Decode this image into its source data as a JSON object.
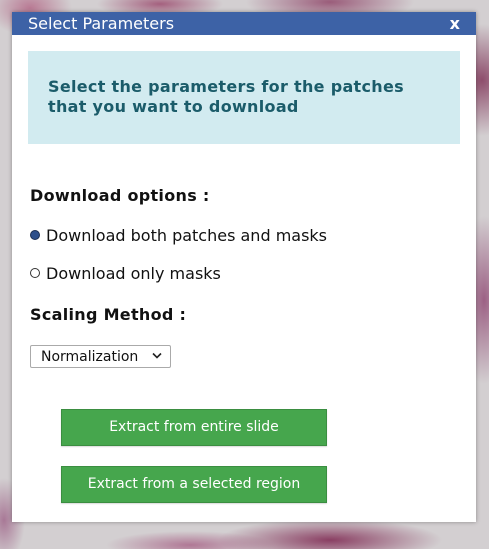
{
  "dialog": {
    "title": "Select Parameters",
    "close_label": "x",
    "info_text": "Select the parameters for the patches that you want to download"
  },
  "download_options": {
    "heading": "Download options :",
    "options": [
      {
        "label": "Download both patches and masks",
        "selected": true
      },
      {
        "label": "Download only masks",
        "selected": false
      }
    ]
  },
  "scaling": {
    "heading": "Scaling Method :",
    "selected": "Normalization"
  },
  "buttons": {
    "extract_entire": "Extract from entire slide",
    "extract_region": "Extract from a selected region"
  },
  "colors": {
    "titlebar": "#3d62a6",
    "info_bg": "#d2ebf0",
    "info_text": "#1b5c6a",
    "button": "#46a64d"
  }
}
